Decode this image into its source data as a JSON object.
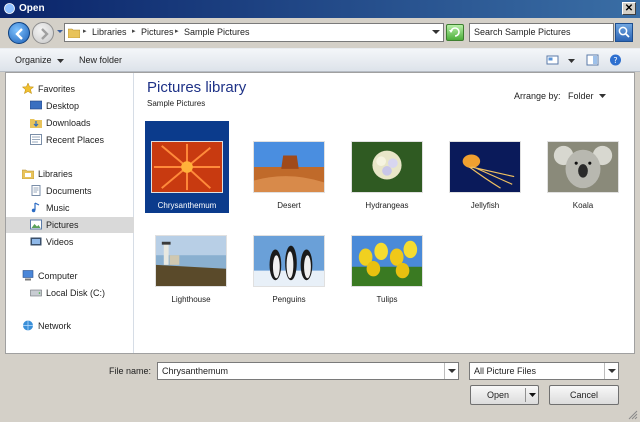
{
  "window": {
    "title": "Open",
    "close_glyph": "✕"
  },
  "address": {
    "crumbs": [
      "Libraries",
      "Pictures",
      "Sample Pictures"
    ],
    "separator": "▸"
  },
  "search": {
    "placeholder": "Search Sample Pictures"
  },
  "toolbar": {
    "organize": "Organize",
    "new_folder": "New folder"
  },
  "nav": {
    "favorites": "Favorites",
    "desktop": "Desktop",
    "downloads": "Downloads",
    "recent_places": "Recent Places",
    "libraries": "Libraries",
    "documents": "Documents",
    "music": "Music",
    "pictures": "Pictures",
    "videos": "Videos",
    "computer": "Computer",
    "local_disk": "Local Disk (C:)",
    "network": "Network"
  },
  "library": {
    "title": "Pictures library",
    "subtitle": "Sample Pictures",
    "arrange_label": "Arrange by:",
    "arrange_value": "Folder"
  },
  "files": [
    {
      "name": "Chrysanthemum",
      "selected": true
    },
    {
      "name": "Desert",
      "selected": false
    },
    {
      "name": "Hydrangeas",
      "selected": false
    },
    {
      "name": "Jellyfish",
      "selected": false
    },
    {
      "name": "Koala",
      "selected": false
    },
    {
      "name": "Lighthouse",
      "selected": false
    },
    {
      "name": "Penguins",
      "selected": false
    },
    {
      "name": "Tulips",
      "selected": false
    }
  ],
  "footer": {
    "filename_label": "File name:",
    "filename_value": "Chrysanthemum",
    "filetype_value": "All Picture Files",
    "open_label": "Open",
    "cancel_label": "Cancel"
  }
}
